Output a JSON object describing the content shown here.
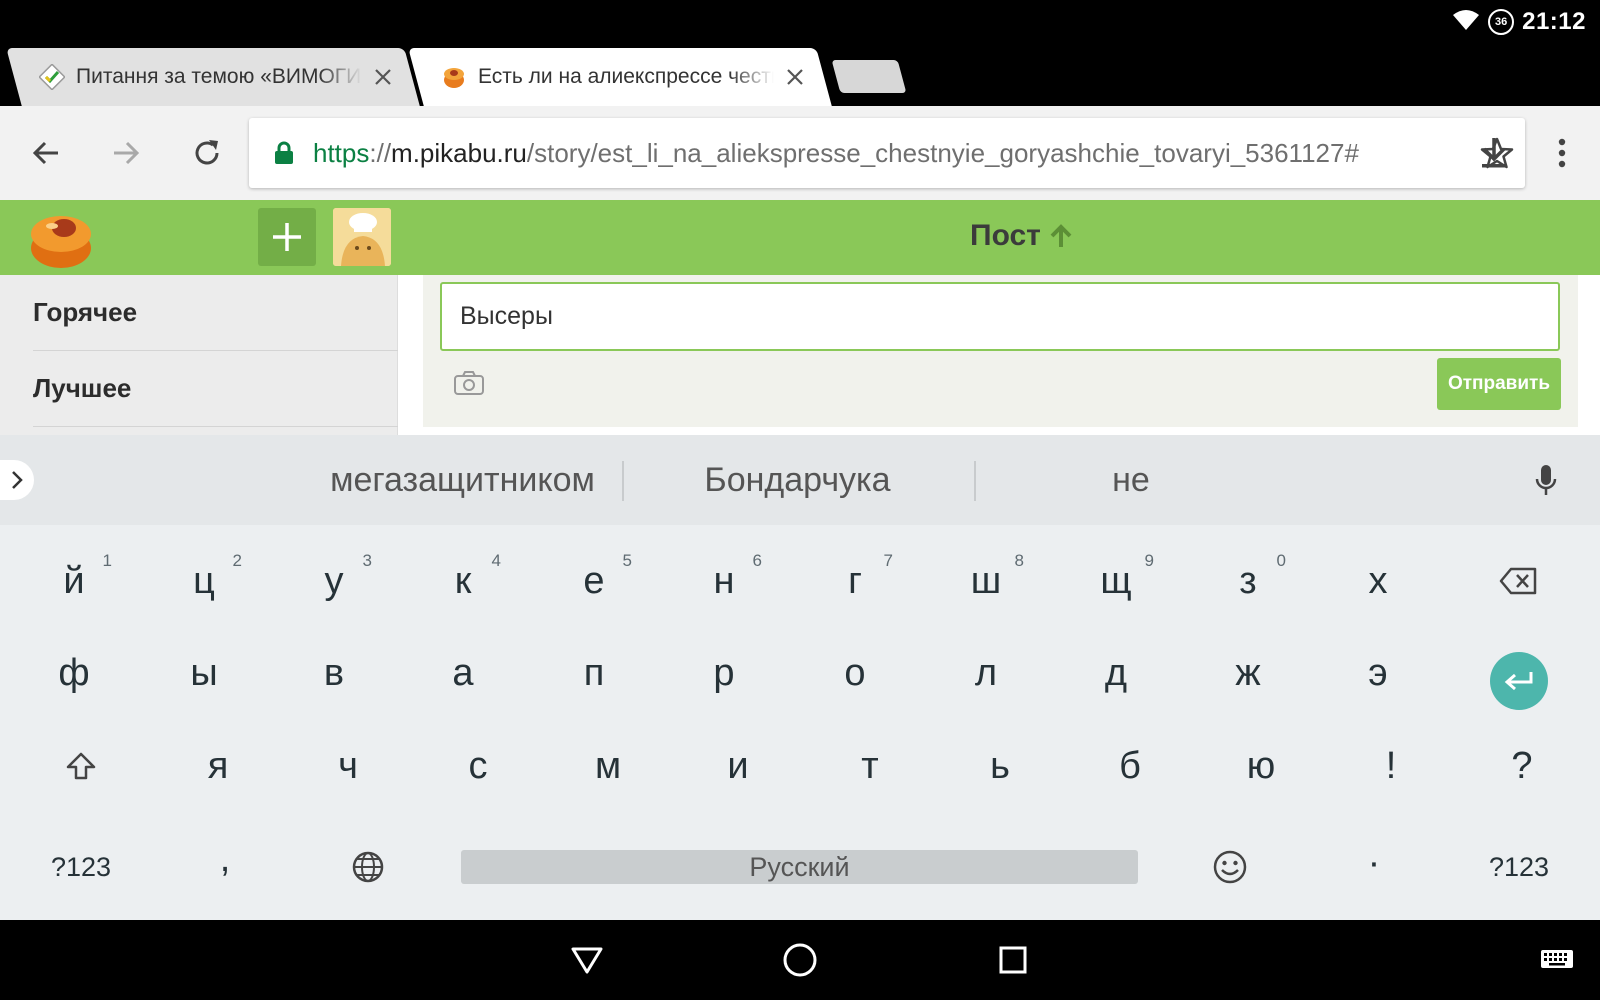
{
  "status_bar": {
    "time": "21:12",
    "signal_badge": "36",
    "icons": [
      "wifi-icon",
      "data-saver-icon"
    ]
  },
  "tabs": [
    {
      "title": "Питання за темою «ВИМОГИ",
      "favicon": "bank-favicon-icon",
      "active": false
    },
    {
      "title": "Есть ли на алиекспрессе честные",
      "favicon": "pikabu-favicon-icon",
      "active": true
    }
  ],
  "toolbar": {
    "url": {
      "scheme": "https",
      "separator": "://",
      "host": "m.pikabu.ru",
      "path": "/story/est_li_na_aliekspresse_chestnyie_goryashchie_tovaryi_5361127#"
    }
  },
  "site_header": {
    "heading": "Пост"
  },
  "sidebar": {
    "items": [
      "Горячее",
      "Лучшее"
    ]
  },
  "comment": {
    "input_value": "Высеры",
    "send_label": "Отправить"
  },
  "keyboard": {
    "suggestions": [
      "мегазащитником",
      "Бондарчука",
      "не"
    ],
    "row1": [
      {
        "label": "й",
        "hint": "1"
      },
      {
        "label": "ц",
        "hint": "2"
      },
      {
        "label": "у",
        "hint": "3"
      },
      {
        "label": "к",
        "hint": "4"
      },
      {
        "label": "е",
        "hint": "5"
      },
      {
        "label": "н",
        "hint": "6"
      },
      {
        "label": "г",
        "hint": "7"
      },
      {
        "label": "ш",
        "hint": "8"
      },
      {
        "label": "щ",
        "hint": "9"
      },
      {
        "label": "з",
        "hint": "0"
      },
      {
        "label": "х",
        "hint": ""
      }
    ],
    "row2": [
      "ф",
      "ы",
      "в",
      "а",
      "п",
      "р",
      "о",
      "л",
      "д",
      "ж",
      "э"
    ],
    "row3": [
      "я",
      "ч",
      "с",
      "м",
      "и",
      "т",
      "ь",
      "б",
      "ю",
      "!",
      "?"
    ],
    "symbols_left": "?123",
    "comma": ",",
    "space_label": "Русский",
    "period": "·",
    "symbols_right": "?123"
  },
  "colors": {
    "brand_green": "#8ac858",
    "enter_teal": "#4db6ac",
    "url_green": "#0b8043"
  }
}
